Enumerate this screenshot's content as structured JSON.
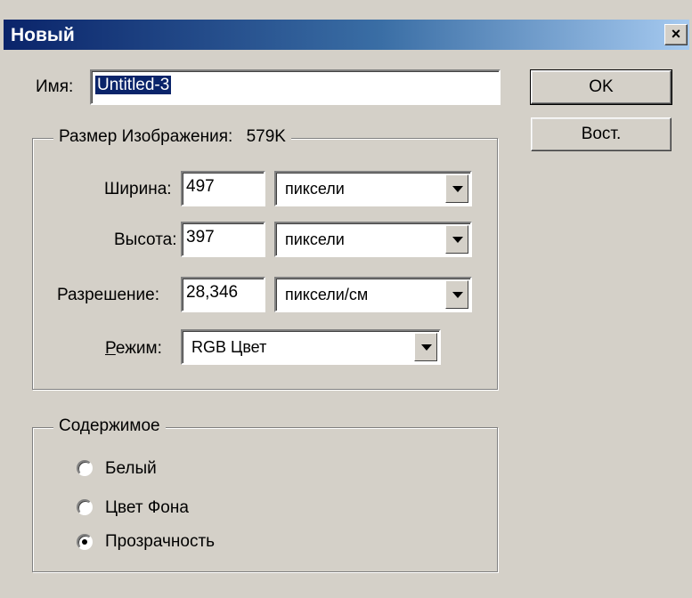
{
  "window": {
    "title": "Новый",
    "close_glyph": "×"
  },
  "name": {
    "label": "Имя:",
    "value": "Untitled-3"
  },
  "buttons": {
    "ok": "OK",
    "reset": "Вост."
  },
  "image_size": {
    "legend": "Размер Изображения:",
    "size_value": "579K",
    "width": {
      "label": "Ширина:",
      "value": "497",
      "unit": "пиксели"
    },
    "height": {
      "label": "Высота:",
      "value": "397",
      "unit": "пиксели"
    },
    "resolution": {
      "label": "Разрешение:",
      "value": "28,346",
      "unit": "пиксели/см"
    },
    "mode": {
      "label_underlined": "Р",
      "label_rest": "ежим:",
      "value": "RGB Цвет"
    }
  },
  "contents": {
    "legend": "Содержимое",
    "options": [
      {
        "label": "Белый",
        "checked": false
      },
      {
        "label": "Цвет Фона",
        "checked": false
      },
      {
        "label": "Прозрачность",
        "checked": true
      }
    ]
  }
}
